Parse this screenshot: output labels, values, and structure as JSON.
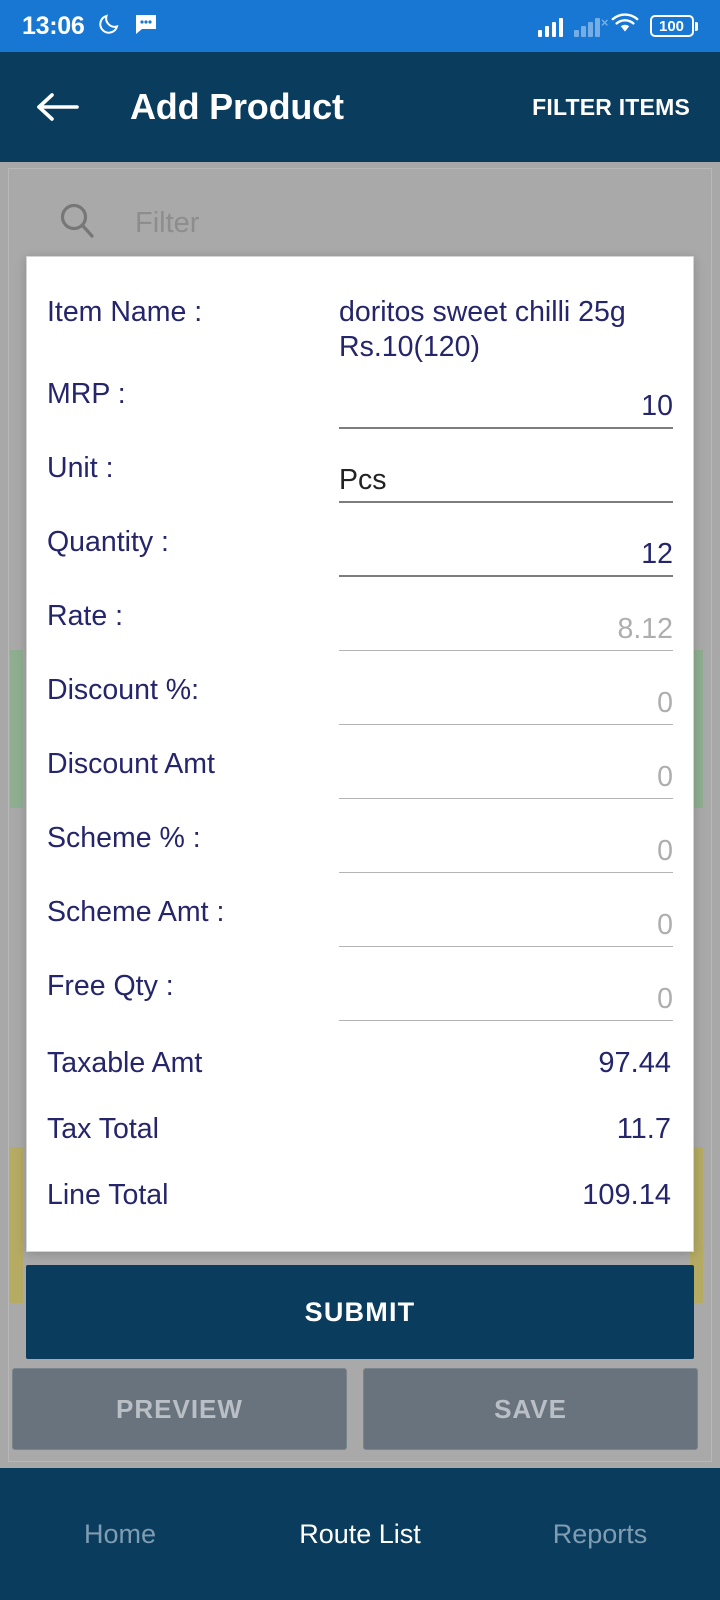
{
  "status_bar": {
    "time": "13:06",
    "moon_icon": "moon-icon",
    "message_icon": "message-icon",
    "signal_icon": "signal-bars-icon",
    "signal2_icon": "signal-bars-no-service-icon",
    "wifi_icon": "wifi-icon",
    "battery_level": "100"
  },
  "app_bar": {
    "back_icon": "back-arrow-icon",
    "title": "Add Product",
    "action_label": "FILTER ITEMS"
  },
  "background": {
    "search_icon": "search-icon",
    "filter_placeholder": "Filter",
    "preview_label": "PREVIEW",
    "save_label": "SAVE"
  },
  "dialog": {
    "rows": [
      {
        "label": "Item Name :",
        "value": "doritos sweet chilli 25g Rs.10(120)",
        "kind": "text"
      },
      {
        "label": "MRP :",
        "value": "10",
        "kind": "input",
        "align": "right",
        "tone": "navy"
      },
      {
        "label": "Unit :",
        "value": "Pcs",
        "kind": "input",
        "align": "left",
        "tone": "dark"
      },
      {
        "label": "Quantity :",
        "value": "12",
        "kind": "input",
        "align": "right",
        "tone": "navy"
      },
      {
        "label": "Rate :",
        "value": "8.12",
        "kind": "input",
        "align": "right",
        "tone": "grey"
      },
      {
        "label": "Discount %:",
        "value": "0",
        "kind": "input",
        "align": "right",
        "tone": "grey"
      },
      {
        "label": "Discount Amt",
        "value": "0",
        "kind": "input",
        "align": "right",
        "tone": "grey"
      },
      {
        "label": "Scheme % :",
        "value": "0",
        "kind": "input",
        "align": "right",
        "tone": "grey"
      },
      {
        "label": "Scheme Amt :",
        "value": "0",
        "kind": "input",
        "align": "right",
        "tone": "grey"
      },
      {
        "label": "Free Qty :",
        "value": "0",
        "kind": "input",
        "align": "right",
        "tone": "grey"
      }
    ],
    "summary": [
      {
        "label": "Taxable Amt",
        "value": "97.44"
      },
      {
        "label": "Tax Total",
        "value": "11.7"
      },
      {
        "label": "Line Total",
        "value": "109.14"
      }
    ]
  },
  "submit": {
    "label": "SUBMIT"
  },
  "bottom_nav": {
    "items": [
      {
        "label": "Home",
        "active": false
      },
      {
        "label": "Route List",
        "active": true
      },
      {
        "label": "Reports",
        "active": false
      }
    ]
  },
  "colors": {
    "status_bar": "#1877d2",
    "app_bar": "#0a3c5e",
    "accent_navy": "#25256b",
    "submit": "#0a3c5e",
    "scrim": "#a8a8a8",
    "strip_green": "#8fae90",
    "strip_yellow": "#b5ab63"
  }
}
